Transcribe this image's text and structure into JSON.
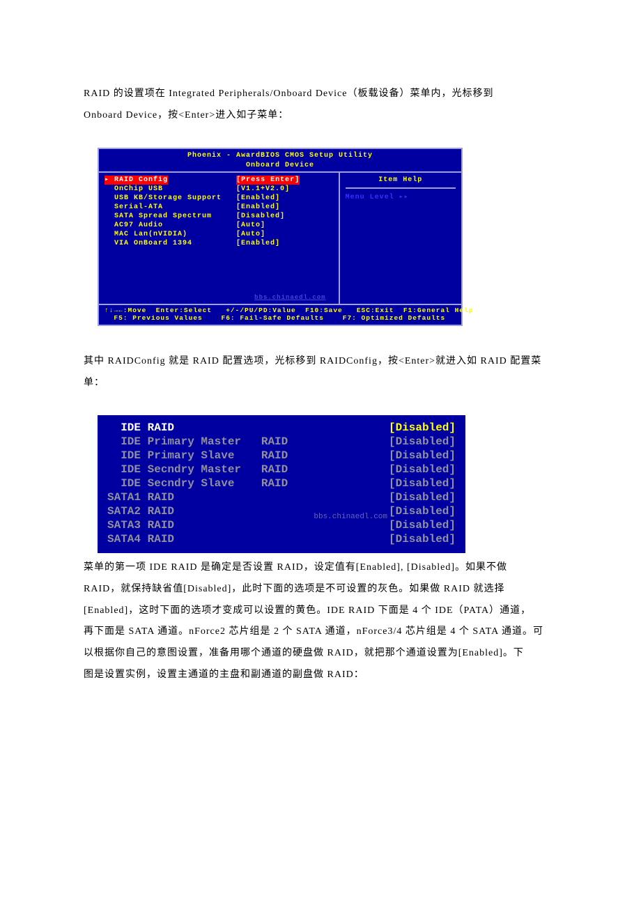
{
  "para1_a": "RAID 的设置项在 Integrated Peripherals/Onboard Device（板载设备）菜单内，光标移到",
  "para1_b": "Onboard Device，按<Enter>进入如子菜单：",
  "bios1": {
    "title": "Phoenix - AwardBIOS CMOS Setup Utility",
    "subtitle": "Onboard Device",
    "rows": [
      {
        "label": "▸ RAID Config",
        "sp": "              ",
        "value": "[Press Enter]",
        "sel": true
      },
      {
        "label": "  OnChip USB",
        "sp": "               ",
        "value": "[V1.1+V2.0]"
      },
      {
        "label": "  USB KB/Storage Support",
        "sp": "   ",
        "value": "[Enabled]"
      },
      {
        "label": "  Serial-ATA",
        "sp": "               ",
        "value": "[Enabled]"
      },
      {
        "label": "  SATA Spread Spectrum",
        "sp": "     ",
        "value": "[Disabled]"
      },
      {
        "label": "  AC97 Audio",
        "sp": "               ",
        "value": "[Auto]"
      },
      {
        "label": "  MAC Lan(nVIDIA)",
        "sp": "          ",
        "value": "[Auto]"
      },
      {
        "label": "  VIA OnBoard 1394",
        "sp": "         ",
        "value": "[Enabled]"
      }
    ],
    "help_title": "Item Help",
    "help_sub": "Menu Level   ▸▸",
    "footer1": "↑↓→←:Move  Enter:Select   +/-/PU/PD:Value  F10:Save   ESC:Exit  F1:General Help",
    "footer2": "  F5: Previous Values    F6: Fail-Safe Defaults    F7: Optimized Defaults",
    "watermark": "bbs.chinaedl.com"
  },
  "para2_a": "其中 RAIDConfig 就是 RAID 配置选项，光标移到 RAIDConfig，按<Enter>就进入如 RAID 配置菜",
  "para2_b": "单：",
  "raid": {
    "rows": [
      {
        "l": "  IDE RAID",
        "v": "[Disabled]",
        "grey": false
      },
      {
        "l": "  IDE Primary Master   RAID",
        "v": "[Disabled]",
        "grey": true
      },
      {
        "l": "  IDE Primary Slave    RAID",
        "v": "[Disabled]",
        "grey": true
      },
      {
        "l": "  IDE Secndry Master   RAID",
        "v": "[Disabled]",
        "grey": true
      },
      {
        "l": "  IDE Secndry Slave    RAID",
        "v": "[Disabled]",
        "grey": true
      },
      {
        "l": "SATA1 RAID",
        "v": "[Disabled]",
        "grey": true
      },
      {
        "l": "SATA2 RAID",
        "v": "[Disabled]",
        "grey": true
      },
      {
        "l": "SATA3 RAID",
        "v": "[Disabled]",
        "grey": true
      },
      {
        "l": "SATA4 RAID",
        "v": "[Disabled]",
        "grey": true
      }
    ],
    "watermark": "bbs.chinaedl.com"
  },
  "para3_a": "菜单的第一项 IDE RAID 是确定是否设置 RAID，设定值有[Enabled], [Disabled]。如果不做",
  "para3_b": "RAID，就保持缺省值[Disabled]，此时下面的选项是不可设置的灰色。如果做 RAID 就选择",
  "para3_c": "[Enabled]，这时下面的选项才变成可以设置的黄色。IDE RAID 下面是 4 个 IDE（PATA）通道，",
  "para3_d": "再下面是 SATA 通道。nForce2 芯片组是 2 个 SATA 通道，nForce3/4 芯片组是 4 个 SATA 通道。可",
  "para3_e": "以根据你自己的意图设置，准备用哪个通道的硬盘做 RAID，就把那个通道设置为[Enabled]。下",
  "para3_f": "图是设置实例，设置主通道的主盘和副通道的副盘做 RAID："
}
